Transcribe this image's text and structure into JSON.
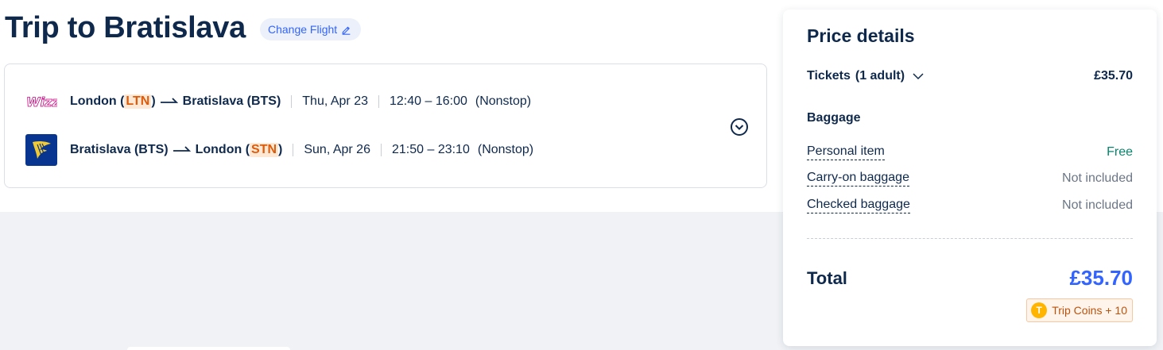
{
  "header": {
    "title": "Trip to Bratislava",
    "change_flight_label": "Change Flight"
  },
  "itinerary": {
    "legs": [
      {
        "airline_icon": "wizz-air-logo",
        "origin_city": "London",
        "origin_code": "LTN",
        "destination_city": "Bratislava",
        "destination_code": "BTS",
        "date": "Thu, Apr 23",
        "time": "12:40 – 16:00",
        "stops": "(Nonstop)"
      },
      {
        "airline_icon": "ryanair-logo",
        "origin_city": "Bratislava",
        "origin_code": "BTS",
        "destination_city": "London",
        "destination_code": "STN",
        "date": "Sun, Apr 26",
        "time": "21:50 – 23:10",
        "stops": "(Nonstop)"
      }
    ]
  },
  "price_details": {
    "title": "Price details",
    "tickets_label": "Tickets",
    "tickets_passengers": "(1 adult)",
    "tickets_price": "£35.70",
    "baggage_heading": "Baggage",
    "baggage": [
      {
        "label": "Personal item",
        "value": "Free"
      },
      {
        "label": "Carry-on baggage",
        "value": "Not included"
      },
      {
        "label": "Checked baggage",
        "value": "Not included"
      }
    ],
    "total_label": "Total",
    "total_value": "£35.70",
    "coins_icon_letter": "T",
    "coins_label": "Trip Coins + 10"
  },
  "colors": {
    "accent": "#3264ff",
    "highlight_bg": "#fde8d6",
    "highlight_text": "#dc5c0c",
    "free": "#06866c",
    "muted": "#6b7686",
    "coin": "#ffb500"
  }
}
